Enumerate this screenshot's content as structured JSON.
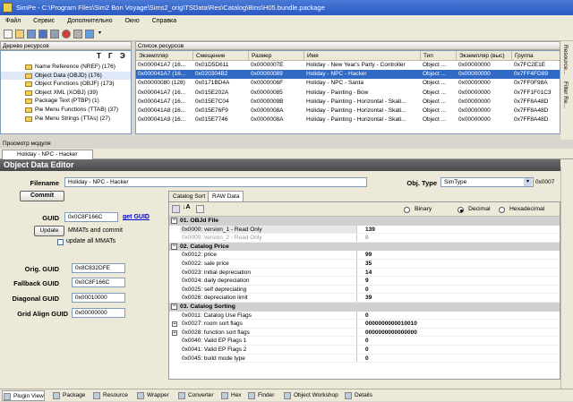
{
  "window": {
    "title": "SimPe - C:\\Program Files\\Sim2 Bon Voyage\\Sims2_orig\\TSData\\Res\\Catalog\\Bins\\H05.bundle.package"
  },
  "menu": [
    "Файл",
    "Сервис",
    "Дополнительно",
    "Окно",
    "Справка"
  ],
  "tree": {
    "header": "Дерево ресурсов",
    "items": [
      {
        "label": "Name Reference (NREF) (176)"
      },
      {
        "label": "Object Data (OBJD) (176)"
      },
      {
        "label": "Object Functions (OBJF) (173)"
      },
      {
        "label": "Object XML (XOBJ) (39)"
      },
      {
        "label": "Package Text (PTBP) (1)"
      },
      {
        "label": "Pie Menu Functions (TTAB) (37)"
      },
      {
        "label": "Pie Menu Strings (TTAs) (27)"
      }
    ]
  },
  "list": {
    "header": "Список ресурсов",
    "columns": [
      "Экземпляр",
      "Смещение",
      "Размер",
      "Имя",
      "Тип",
      "Экземпляр (выс)",
      "Группа"
    ],
    "rows": [
      [
        "0x000041A7 (16...",
        "0x01D5D611",
        "0x0000007E",
        "Holiday - New Year's Party - Controller",
        "Object ...",
        "0x00000000",
        "0x7FC2E1E"
      ],
      [
        "0x000041A7 (16...",
        "0x020304B2",
        "0x00000089",
        "Holiday - NPC - Hacker",
        "Object ...",
        "0x00000000",
        "0x7FF4FD89"
      ],
      [
        "0x00000080 (128)",
        "0x0171BD4A",
        "0x0000006F",
        "Holiday - NPC - Santa",
        "Object ...",
        "0x00000000",
        "0x7FF0F98A"
      ],
      [
        "0x000041A7 (16...",
        "0x015E202A",
        "0x00000085",
        "Holiday - Painting - Bow",
        "Object ...",
        "0x00000000",
        "0x7FF1F01C3"
      ],
      [
        "0x000041A7 (16...",
        "0x015E7C04",
        "0x0000009B",
        "Holiday - Painting - Horizontal - Skati...",
        "Object ...",
        "0x00000000",
        "0x7FF8A48D"
      ],
      [
        "0x000041A8 (16...",
        "0x015E76F9",
        "0x0000008A",
        "Holiday - Painting - Horizontal - Skati...",
        "Object ...",
        "0x00000000",
        "0x7FF8A48D"
      ],
      [
        "0x000041A9 (16...",
        "0x015E7746",
        "0x0000008A",
        "Holiday - Painting - Horizontal - Skati...",
        "Object ...",
        "0x00000000",
        "0x7FF8A48D"
      ]
    ],
    "selected_row": 1
  },
  "right_tabs": [
    "Resource...",
    "Filter Re..."
  ],
  "module": {
    "title": "Просмотр модуля",
    "tab": "Holiday - NPC - Hacker"
  },
  "editor": {
    "title": "Object Data Editor",
    "filename_label": "Filename",
    "filename": "Holiday - NPC - Hacker",
    "objtype_label": "Obj. Type",
    "objtype": "SimType",
    "objtype_code": "0x0007",
    "commit": "Commit",
    "guid_label": "GUID",
    "guid": "0x0C8F166C",
    "get_guid": "get GUID",
    "update": "Update",
    "update_text": "MMATs and commit",
    "update_all": "update all MMATs",
    "orig_guid_label": "Orig. GUID",
    "orig_guid": "0x8C832DFE",
    "fallback_guid_label": "Fallback GUID",
    "fallback_guid": "0x0C8F166C",
    "diagonal_guid_label": "Diagonal GUID",
    "diagonal_guid": "0x00010000",
    "grid_align_guid_label": "Grid Align GUID",
    "grid_align_guid": "0x00000000"
  },
  "inner_tabs": [
    "Catalog Sort",
    "RAW Data"
  ],
  "radios": {
    "binary": "Binary",
    "decimal": "Decimal",
    "hexadecimal": "Hexadecimal",
    "selected": "decimal"
  },
  "grid": [
    {
      "cat": "01. OBJd File",
      "rows": [
        {
          "k": "0x0000: version_1 - Read Only",
          "v": "139",
          "ro": false
        },
        {
          "k": "0x0000: version_2 - Read Only",
          "v": "0",
          "ro": true
        }
      ]
    },
    {
      "cat": "02. Catalog Price",
      "rows": [
        {
          "k": "0x0012: price",
          "v": "99"
        },
        {
          "k": "0x0022: sale price",
          "v": "35"
        },
        {
          "k": "0x0023: initial depreciation",
          "v": "14"
        },
        {
          "k": "0x0024: daily depreciation",
          "v": "9"
        },
        {
          "k": "0x0025: self depreciating",
          "v": "0"
        },
        {
          "k": "0x0026: depreciation limit",
          "v": "39"
        }
      ]
    },
    {
      "cat": "03. Catalog Sorting",
      "rows": [
        {
          "k": "0x0011: Catalog Use Flags",
          "v": "0"
        },
        {
          "k": "0x0027: room sort flags",
          "v": "0000000000010010",
          "exp": true
        },
        {
          "k": "0x0028: function sort flags",
          "v": "0000000000000000",
          "exp": true
        },
        {
          "k": "0x0040: Valid EP Flags 1",
          "v": "0"
        },
        {
          "k": "0x0041: Valid EP Flags 2",
          "v": "0"
        },
        {
          "k": "0x0045: build mode type",
          "v": "0"
        }
      ]
    }
  ],
  "statusbar": [
    "Plugin View",
    "Package",
    "Resource",
    "Wrapper",
    "Converter",
    "Hex",
    "Finder",
    "Object Workshop",
    "Details"
  ]
}
